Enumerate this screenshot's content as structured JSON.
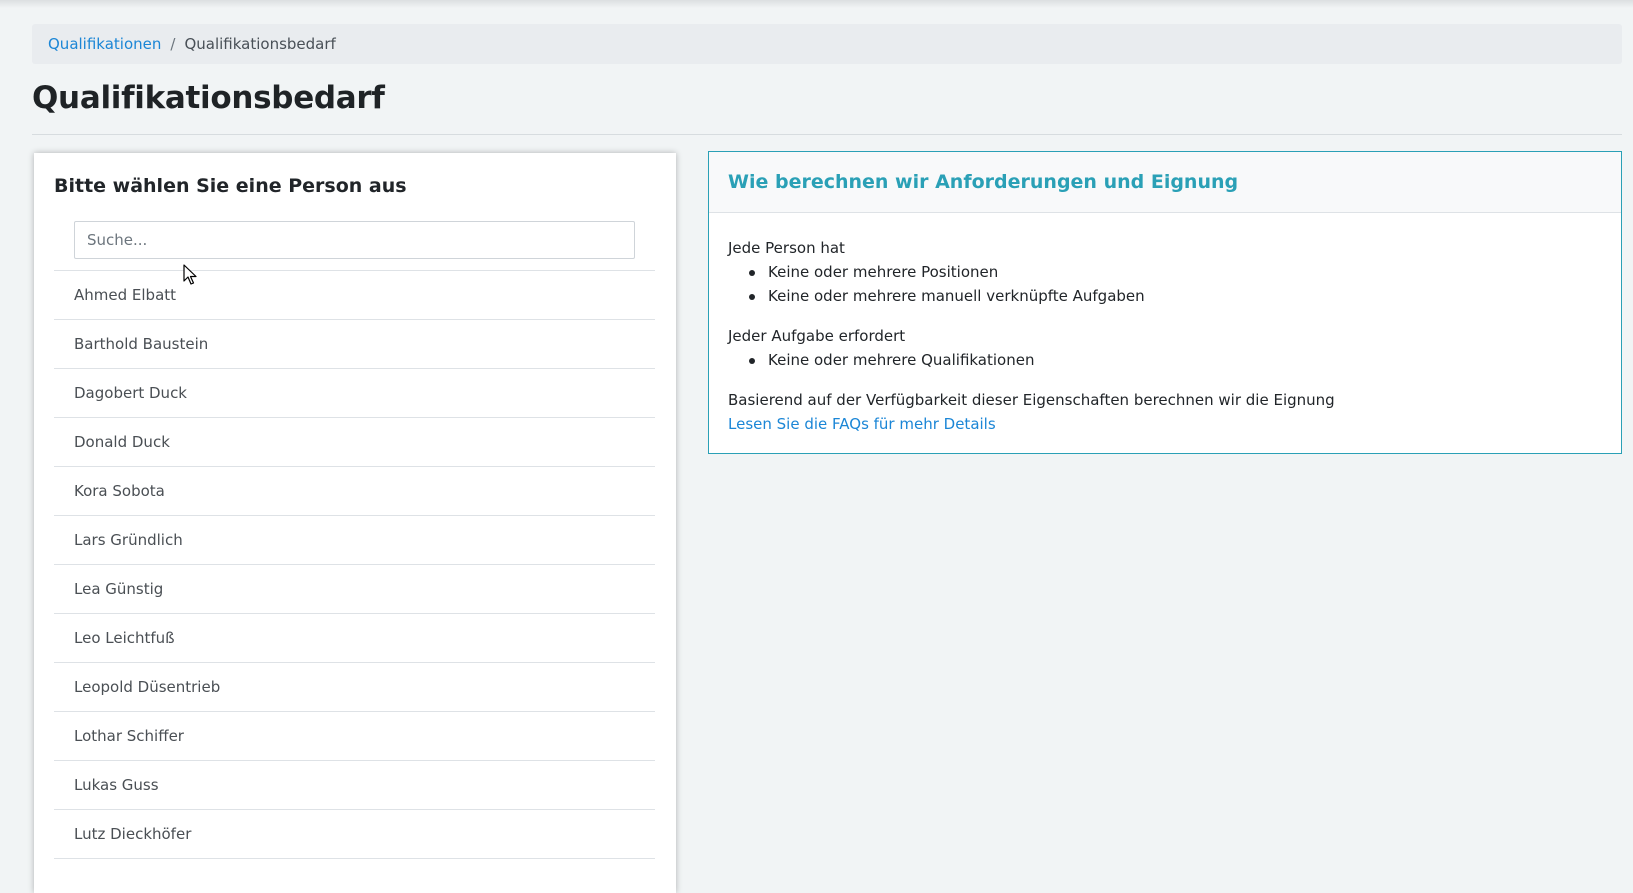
{
  "breadcrumb": {
    "parent_label": "Qualifikationen",
    "separator": "/",
    "current_label": "Qualifikationsbedarf"
  },
  "page": {
    "title": "Qualifikationsbedarf"
  },
  "person_panel": {
    "heading": "Bitte wählen Sie eine Person aus",
    "search": {
      "placeholder": "Suche...",
      "value": ""
    },
    "persons": [
      "Ahmed Elbatt",
      "Barthold Baustein",
      "Dagobert Duck",
      "Donald Duck",
      "Kora Sobota",
      "Lars Gründlich",
      "Lea Günstig",
      "Leo Leichtfuß",
      "Leopold Düsentrieb",
      "Lothar Schiffer",
      "Lukas Guss",
      "Lutz Dieckhöfer"
    ]
  },
  "info_panel": {
    "heading": "Wie berechnen wir Anforderungen und Eignung",
    "person_intro": "Jede Person hat",
    "person_items": [
      "Keine oder mehrere Positionen",
      "Keine oder mehrere manuell verknüpfte Aufgaben"
    ],
    "task_intro": "Jeder Aufgabe erfordert",
    "task_items": [
      "Keine oder mehrere Qualifikationen"
    ],
    "summary": "Basierend auf der Verfügbarkeit dieser Eigenschaften berechnen wir die Eignung",
    "faq_link": "Lesen Sie die FAQs für mehr Details"
  },
  "colors": {
    "accent": "#2aa0b6",
    "link": "#1b86d6",
    "page_background": "#f1f4f5"
  }
}
